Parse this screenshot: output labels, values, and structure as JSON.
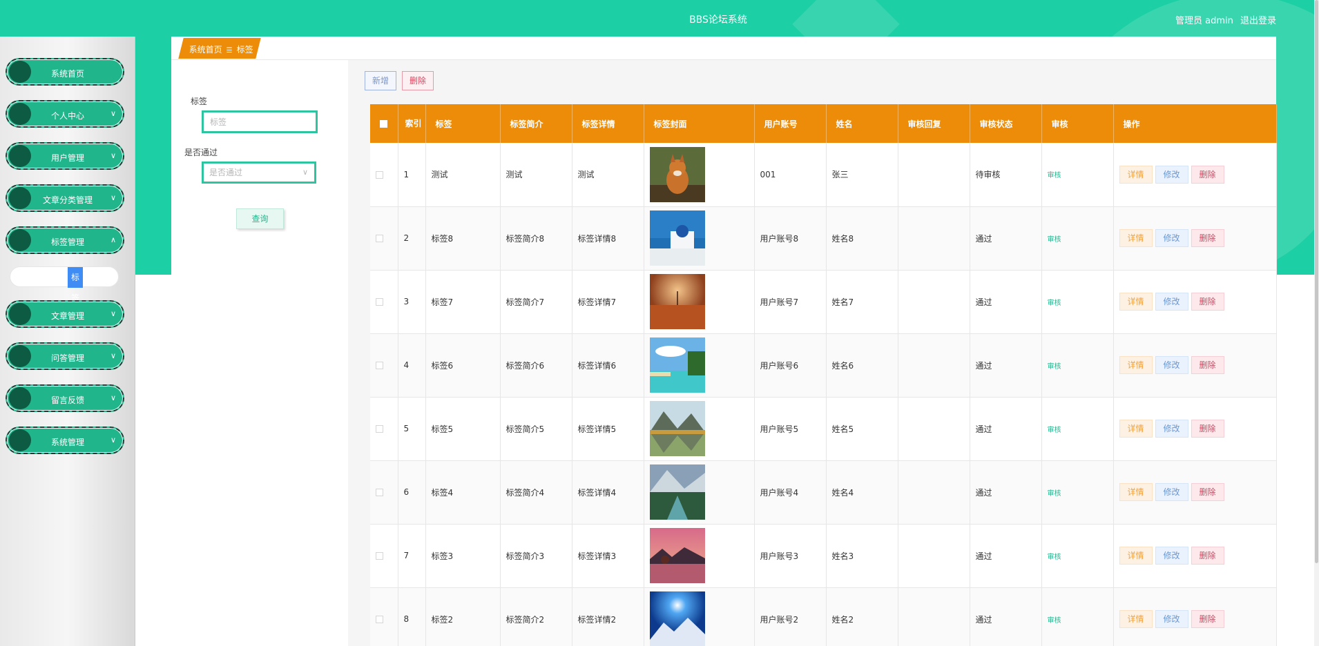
{
  "header": {
    "title": "BBS论坛系统",
    "user_label": "管理员 admin",
    "logout_label": "退出登录"
  },
  "sidebar": {
    "items": [
      {
        "label": "系统首页",
        "arrow": ""
      },
      {
        "label": "个人中心",
        "arrow": "∨"
      },
      {
        "label": "用户管理",
        "arrow": "∨"
      },
      {
        "label": "文章分类管理",
        "arrow": "∨"
      },
      {
        "label": "标签管理",
        "arrow": "∧"
      },
      {
        "label": "文章管理",
        "arrow": "∨"
      },
      {
        "label": "问答管理",
        "arrow": "∨"
      },
      {
        "label": "留言反馈",
        "arrow": "∨"
      },
      {
        "label": "系统管理",
        "arrow": "∨"
      }
    ],
    "sub_item": "标签"
  },
  "breadcrumb": {
    "home": "系统首页",
    "sep": "☰",
    "current": "标签"
  },
  "search": {
    "tag_label": "标签",
    "tag_placeholder": "标签",
    "pass_label": "是否通过",
    "pass_placeholder": "是否通过",
    "query_button": "查询"
  },
  "toolbar": {
    "add_label": "新增",
    "delete_label": "删除"
  },
  "table": {
    "headers": [
      "",
      "索引",
      "标签",
      "标签简介",
      "标签详情",
      "标签封面",
      "用户账号",
      "姓名",
      "审核回复",
      "审核状态",
      "审核",
      "操作"
    ],
    "rows": [
      {
        "index": "1",
        "tag": "测试",
        "intro": "测试",
        "detail": "测试",
        "account": "001",
        "name": "张三",
        "reply": "",
        "status": "待审核",
        "audit": "审核",
        "img": "fox"
      },
      {
        "index": "2",
        "tag": "标签8",
        "intro": "标签简介8",
        "detail": "标签详情8",
        "account": "用户账号8",
        "name": "姓名8",
        "reply": "",
        "status": "通过",
        "audit": "审核",
        "img": "santorini"
      },
      {
        "index": "3",
        "tag": "标签7",
        "intro": "标签简介7",
        "detail": "标签详情7",
        "account": "用户账号7",
        "name": "姓名7",
        "reply": "",
        "status": "通过",
        "audit": "审核",
        "img": "desert"
      },
      {
        "index": "4",
        "tag": "标签6",
        "intro": "标签简介6",
        "detail": "标签详情6",
        "account": "用户账号6",
        "name": "姓名6",
        "reply": "",
        "status": "通过",
        "audit": "审核",
        "img": "beach"
      },
      {
        "index": "5",
        "tag": "标签5",
        "intro": "标签简介5",
        "detail": "标签详情5",
        "account": "用户账号5",
        "name": "姓名5",
        "reply": "",
        "status": "通过",
        "audit": "审核",
        "img": "lake"
      },
      {
        "index": "6",
        "tag": "标签4",
        "intro": "标签简介4",
        "detail": "标签详情4",
        "account": "用户账号4",
        "name": "姓名4",
        "reply": "",
        "status": "通过",
        "audit": "审核",
        "img": "river"
      },
      {
        "index": "7",
        "tag": "标签3",
        "intro": "标签简介3",
        "detail": "标签详情3",
        "account": "用户账号3",
        "name": "姓名3",
        "reply": "",
        "status": "通过",
        "audit": "审核",
        "img": "sunset"
      },
      {
        "index": "8",
        "tag": "标签2",
        "intro": "标签简介2",
        "detail": "标签详情2",
        "account": "用户账号2",
        "name": "姓名2",
        "reply": "",
        "status": "通过",
        "audit": "审核",
        "img": "mountain"
      }
    ],
    "actions": {
      "view": "详情",
      "edit": "修改",
      "delete": "删除"
    }
  },
  "colors": {
    "primary": "#1ccfa4",
    "header_orange": "#ec8c08",
    "menu_green": "#21b58c"
  }
}
